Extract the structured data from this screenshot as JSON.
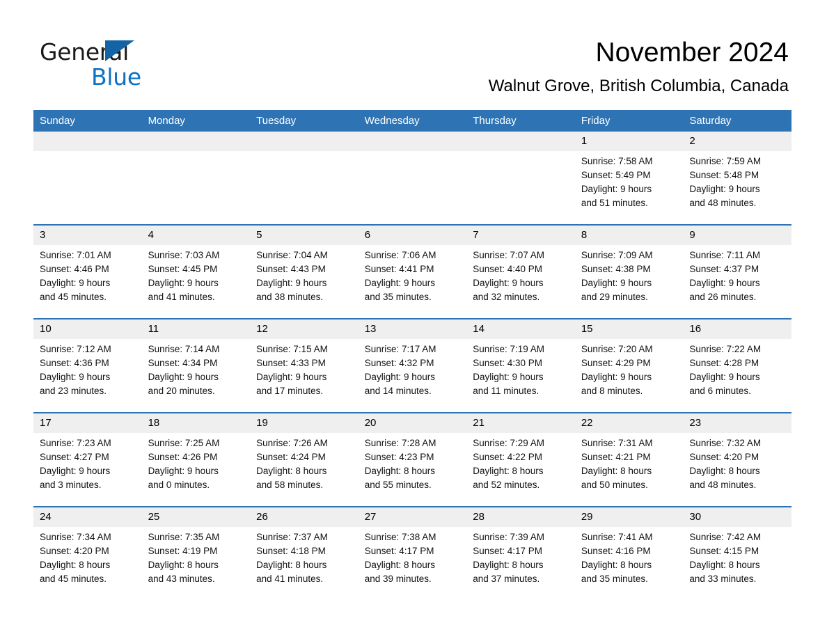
{
  "brand": {
    "name_part1": "General",
    "name_part2": "Blue",
    "triangle_color": "#1464a5",
    "blue_color": "#0d72c4"
  },
  "header": {
    "month_title": "November 2024",
    "location": "Walnut Grove, British Columbia, Canada"
  },
  "theme": {
    "header_blue": "#2e74b5",
    "daynum_band": "#efefef",
    "cell_background": "#ffffff"
  },
  "calendar": {
    "weekday_headers": [
      "Sunday",
      "Monday",
      "Tuesday",
      "Wednesday",
      "Thursday",
      "Friday",
      "Saturday"
    ],
    "weeks": [
      [
        {
          "day": "",
          "lines": []
        },
        {
          "day": "",
          "lines": []
        },
        {
          "day": "",
          "lines": []
        },
        {
          "day": "",
          "lines": []
        },
        {
          "day": "",
          "lines": []
        },
        {
          "day": "1",
          "lines": [
            "Sunrise: 7:58 AM",
            "Sunset: 5:49 PM",
            "Daylight: 9 hours",
            "and 51 minutes."
          ]
        },
        {
          "day": "2",
          "lines": [
            "Sunrise: 7:59 AM",
            "Sunset: 5:48 PM",
            "Daylight: 9 hours",
            "and 48 minutes."
          ]
        }
      ],
      [
        {
          "day": "3",
          "lines": [
            "Sunrise: 7:01 AM",
            "Sunset: 4:46 PM",
            "Daylight: 9 hours",
            "and 45 minutes."
          ]
        },
        {
          "day": "4",
          "lines": [
            "Sunrise: 7:03 AM",
            "Sunset: 4:45 PM",
            "Daylight: 9 hours",
            "and 41 minutes."
          ]
        },
        {
          "day": "5",
          "lines": [
            "Sunrise: 7:04 AM",
            "Sunset: 4:43 PM",
            "Daylight: 9 hours",
            "and 38 minutes."
          ]
        },
        {
          "day": "6",
          "lines": [
            "Sunrise: 7:06 AM",
            "Sunset: 4:41 PM",
            "Daylight: 9 hours",
            "and 35 minutes."
          ]
        },
        {
          "day": "7",
          "lines": [
            "Sunrise: 7:07 AM",
            "Sunset: 4:40 PM",
            "Daylight: 9 hours",
            "and 32 minutes."
          ]
        },
        {
          "day": "8",
          "lines": [
            "Sunrise: 7:09 AM",
            "Sunset: 4:38 PM",
            "Daylight: 9 hours",
            "and 29 minutes."
          ]
        },
        {
          "day": "9",
          "lines": [
            "Sunrise: 7:11 AM",
            "Sunset: 4:37 PM",
            "Daylight: 9 hours",
            "and 26 minutes."
          ]
        }
      ],
      [
        {
          "day": "10",
          "lines": [
            "Sunrise: 7:12 AM",
            "Sunset: 4:36 PM",
            "Daylight: 9 hours",
            "and 23 minutes."
          ]
        },
        {
          "day": "11",
          "lines": [
            "Sunrise: 7:14 AM",
            "Sunset: 4:34 PM",
            "Daylight: 9 hours",
            "and 20 minutes."
          ]
        },
        {
          "day": "12",
          "lines": [
            "Sunrise: 7:15 AM",
            "Sunset: 4:33 PM",
            "Daylight: 9 hours",
            "and 17 minutes."
          ]
        },
        {
          "day": "13",
          "lines": [
            "Sunrise: 7:17 AM",
            "Sunset: 4:32 PM",
            "Daylight: 9 hours",
            "and 14 minutes."
          ]
        },
        {
          "day": "14",
          "lines": [
            "Sunrise: 7:19 AM",
            "Sunset: 4:30 PM",
            "Daylight: 9 hours",
            "and 11 minutes."
          ]
        },
        {
          "day": "15",
          "lines": [
            "Sunrise: 7:20 AM",
            "Sunset: 4:29 PM",
            "Daylight: 9 hours",
            "and 8 minutes."
          ]
        },
        {
          "day": "16",
          "lines": [
            "Sunrise: 7:22 AM",
            "Sunset: 4:28 PM",
            "Daylight: 9 hours",
            "and 6 minutes."
          ]
        }
      ],
      [
        {
          "day": "17",
          "lines": [
            "Sunrise: 7:23 AM",
            "Sunset: 4:27 PM",
            "Daylight: 9 hours",
            "and 3 minutes."
          ]
        },
        {
          "day": "18",
          "lines": [
            "Sunrise: 7:25 AM",
            "Sunset: 4:26 PM",
            "Daylight: 9 hours",
            "and 0 minutes."
          ]
        },
        {
          "day": "19",
          "lines": [
            "Sunrise: 7:26 AM",
            "Sunset: 4:24 PM",
            "Daylight: 8 hours",
            "and 58 minutes."
          ]
        },
        {
          "day": "20",
          "lines": [
            "Sunrise: 7:28 AM",
            "Sunset: 4:23 PM",
            "Daylight: 8 hours",
            "and 55 minutes."
          ]
        },
        {
          "day": "21",
          "lines": [
            "Sunrise: 7:29 AM",
            "Sunset: 4:22 PM",
            "Daylight: 8 hours",
            "and 52 minutes."
          ]
        },
        {
          "day": "22",
          "lines": [
            "Sunrise: 7:31 AM",
            "Sunset: 4:21 PM",
            "Daylight: 8 hours",
            "and 50 minutes."
          ]
        },
        {
          "day": "23",
          "lines": [
            "Sunrise: 7:32 AM",
            "Sunset: 4:20 PM",
            "Daylight: 8 hours",
            "and 48 minutes."
          ]
        }
      ],
      [
        {
          "day": "24",
          "lines": [
            "Sunrise: 7:34 AM",
            "Sunset: 4:20 PM",
            "Daylight: 8 hours",
            "and 45 minutes."
          ]
        },
        {
          "day": "25",
          "lines": [
            "Sunrise: 7:35 AM",
            "Sunset: 4:19 PM",
            "Daylight: 8 hours",
            "and 43 minutes."
          ]
        },
        {
          "day": "26",
          "lines": [
            "Sunrise: 7:37 AM",
            "Sunset: 4:18 PM",
            "Daylight: 8 hours",
            "and 41 minutes."
          ]
        },
        {
          "day": "27",
          "lines": [
            "Sunrise: 7:38 AM",
            "Sunset: 4:17 PM",
            "Daylight: 8 hours",
            "and 39 minutes."
          ]
        },
        {
          "day": "28",
          "lines": [
            "Sunrise: 7:39 AM",
            "Sunset: 4:17 PM",
            "Daylight: 8 hours",
            "and 37 minutes."
          ]
        },
        {
          "day": "29",
          "lines": [
            "Sunrise: 7:41 AM",
            "Sunset: 4:16 PM",
            "Daylight: 8 hours",
            "and 35 minutes."
          ]
        },
        {
          "day": "30",
          "lines": [
            "Sunrise: 7:42 AM",
            "Sunset: 4:15 PM",
            "Daylight: 8 hours",
            "and 33 minutes."
          ]
        }
      ]
    ]
  }
}
